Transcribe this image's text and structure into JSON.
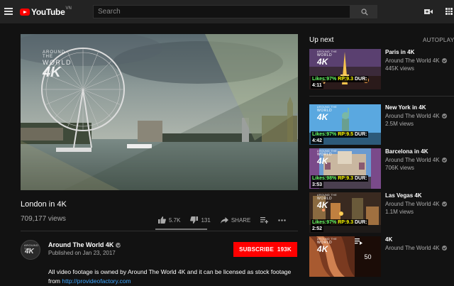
{
  "header": {
    "logo_text": "YouTube",
    "logo_country": "VN",
    "search_placeholder": "Search"
  },
  "video": {
    "watermark_line1": "AROUND THE",
    "watermark_line2": "WORLD",
    "watermark_line3": "4K",
    "title": "London in 4K",
    "views": "709,177 views",
    "likes": "5.7K",
    "dislikes": "131",
    "share_label": "SHARE"
  },
  "channel": {
    "avatar_line1": "AROUND THE",
    "avatar_line2": "4K",
    "name": "Around The World 4K",
    "published": "Published on Jan 23, 2017",
    "subscribe_label": "SUBSCRIBE",
    "subscriber_count": "193K"
  },
  "description": {
    "text": "All video footage is owned by Around The World 4K and it can be licensed as stock footage",
    "from_label": "from",
    "link": "http://provideofactory.com"
  },
  "sidebar": {
    "up_next_label": "Up next",
    "autoplay_label": "AUTOPLAY",
    "items": [
      {
        "title": "Paris in 4K",
        "channel": "Around The World 4K",
        "views": "445K views",
        "likes": "Likes:97%",
        "rp": "RP:9.3",
        "dur_label": "DUR:",
        "duration": "4:11",
        "wm1": "AROUND THE",
        "wm2": "WORLD",
        "wm3": "4K"
      },
      {
        "title": "New York in 4K",
        "channel": "Around The World 4K",
        "views": "2.5M views",
        "likes": "Likes:97%",
        "rp": "RP:9.5",
        "dur_label": "DUR:",
        "duration": "4:42",
        "wm1": "AROUND THE",
        "wm2": "WORLD",
        "wm3": "4K"
      },
      {
        "title": "Barcelona in 4K",
        "channel": "Around The World 4K",
        "views": "706K views",
        "likes": "Likes:98%",
        "rp": "RP:9.3",
        "dur_label": "DUR:",
        "duration": "3:53",
        "wm1": "AROUND THE",
        "wm2": "WORLD",
        "wm3": "4K"
      },
      {
        "title": "Las Vegas 4K",
        "channel": "Around The World 4K",
        "views": "1.1M views",
        "likes": "Likes:97%",
        "rp": "RP:9.3",
        "dur_label": "DUR:",
        "duration": "2:52",
        "wm1": "AROUND THE",
        "wm2": "WORLD",
        "wm3": "4K"
      },
      {
        "title": "4K",
        "channel": "Around The World 4K",
        "playlist_count": "50",
        "wm1": "AROUND THE",
        "wm2": "WORLD",
        "wm3": "4K"
      }
    ]
  },
  "colors": {
    "background": "#121212",
    "topbar": "#232323",
    "accent_red": "#ff0000",
    "link_blue": "#3ea6ff",
    "like_green": "#66ff66",
    "rp_yellow": "#ffff00"
  }
}
